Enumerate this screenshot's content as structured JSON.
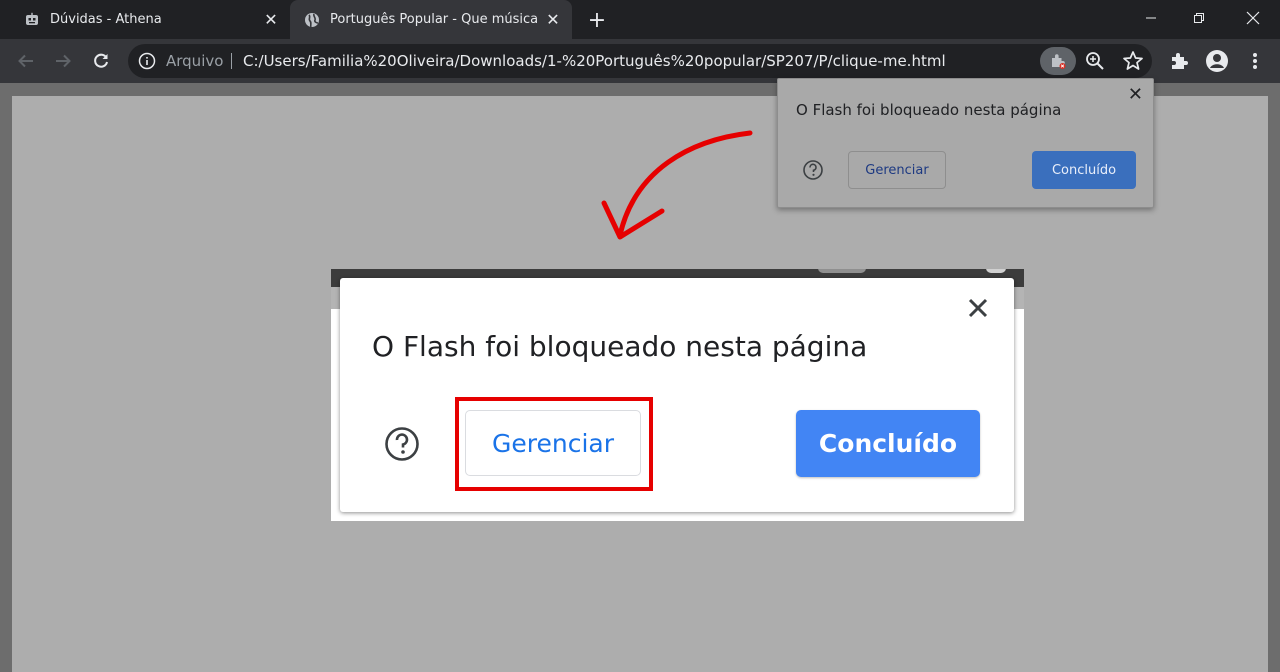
{
  "tabs": [
    {
      "title": "Dúvidas - Athena",
      "favicon": "robot-icon",
      "close": "✕"
    },
    {
      "title": "Português Popular - Que música",
      "favicon": "globe-icon",
      "close": "✕"
    }
  ],
  "new_tab": "+",
  "omnibox": {
    "scheme_label": "Arquivo",
    "url": "C:/Users/Familia%20Oliveira/Downloads/1-%20Português%20popular/SP207/P/clique-me.html"
  },
  "popup": {
    "title": "O Flash foi bloqueado nesta página",
    "close": "✕",
    "manage_label": "Gerenciar",
    "done_label": "Concluído"
  },
  "zoomed_dialog": {
    "title": "O Flash foi bloqueado nesta página",
    "manage_label": "Gerenciar",
    "done_label": "Concluído"
  },
  "colors": {
    "highlight": "#e60000",
    "arrow": "#e60000",
    "done_button": "#4285f4",
    "manage_text": "#1a73e8"
  }
}
